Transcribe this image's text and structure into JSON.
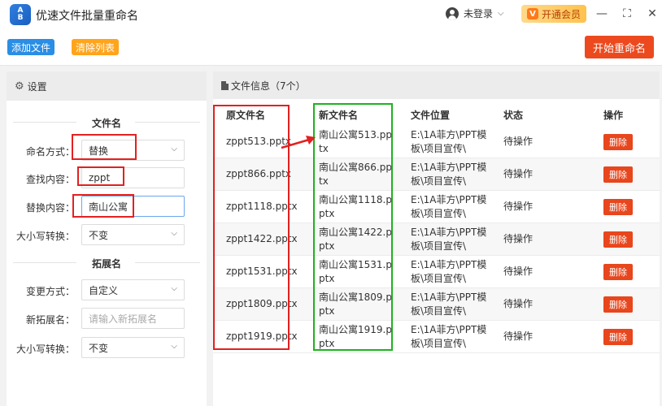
{
  "app": {
    "logo_top": "A",
    "logo_bottom": "B",
    "title": "优速文件批量重命名",
    "login_label": "未登录",
    "vip_icon": "V",
    "vip_label": "开通会员",
    "window_controls": [
      "minimize-icon",
      "maximize-icon",
      "close-icon"
    ]
  },
  "toolbar": {
    "add_label": "添加文件",
    "clear_label": "清除列表",
    "start_label": "开始重命名"
  },
  "settings": {
    "header": "设置",
    "filename_section": "文件名",
    "naming_mode_label": "命名方式：",
    "naming_mode_value": "替换",
    "find_label": "查找内容：",
    "find_value": "zppt",
    "replace_label": "替换内容：",
    "replace_value": "南山公寓",
    "case_label": "大小写转换：",
    "case_value": "不变",
    "ext_section": "拓展名",
    "change_mode_label": "变更方式：",
    "change_mode_value": "自定义",
    "new_ext_label": "新拓展名：",
    "new_ext_placeholder": "请输入新拓展名",
    "ext_case_label": "大小写转换：",
    "ext_case_value": "不变"
  },
  "files": {
    "header": "文件信息（7个）",
    "columns": {
      "original": "原文件名",
      "new": "新文件名",
      "location": "文件位置",
      "status": "状态",
      "action": "操作"
    },
    "rows": [
      {
        "original": "zppt513.pptx",
        "new": "南山公寓513.pptx",
        "location": "E:\\1A菲方\\PPT模板\\项目宣传\\",
        "status": "待操作",
        "action": "删除"
      },
      {
        "original": "zppt866.pptx",
        "new": "南山公寓866.pptx",
        "location": "E:\\1A菲方\\PPT模板\\项目宣传\\",
        "status": "待操作",
        "action": "删除"
      },
      {
        "original": "zppt1118.pptx",
        "new": "南山公寓1118.pptx",
        "location": "E:\\1A菲方\\PPT模板\\项目宣传\\",
        "status": "待操作",
        "action": "删除"
      },
      {
        "original": "zppt1422.pptx",
        "new": "南山公寓1422.pptx",
        "location": "E:\\1A菲方\\PPT模板\\项目宣传\\",
        "status": "待操作",
        "action": "删除"
      },
      {
        "original": "zppt1531.pptx",
        "new": "南山公寓1531.pptx",
        "location": "E:\\1A菲方\\PPT模板\\项目宣传\\",
        "status": "待操作",
        "action": "删除"
      },
      {
        "original": "zppt1809.pptx",
        "new": "南山公寓1809.pptx",
        "location": "E:\\1A菲方\\PPT模板\\项目宣传\\",
        "status": "待操作",
        "action": "删除"
      },
      {
        "original": "zppt1919.pptx",
        "new": "南山公寓1919.pptx",
        "location": "E:\\1A菲方\\PPT模板\\项目宣传\\",
        "status": "待操作",
        "action": "删除"
      }
    ]
  },
  "colors": {
    "add_button": "#2a8ee5",
    "clear_button": "#ffa41b",
    "start_button": "#ec4a1e",
    "delete_button": "#e8461d",
    "highlight_red": "#e32020",
    "highlight_green": "#1fb21f"
  }
}
